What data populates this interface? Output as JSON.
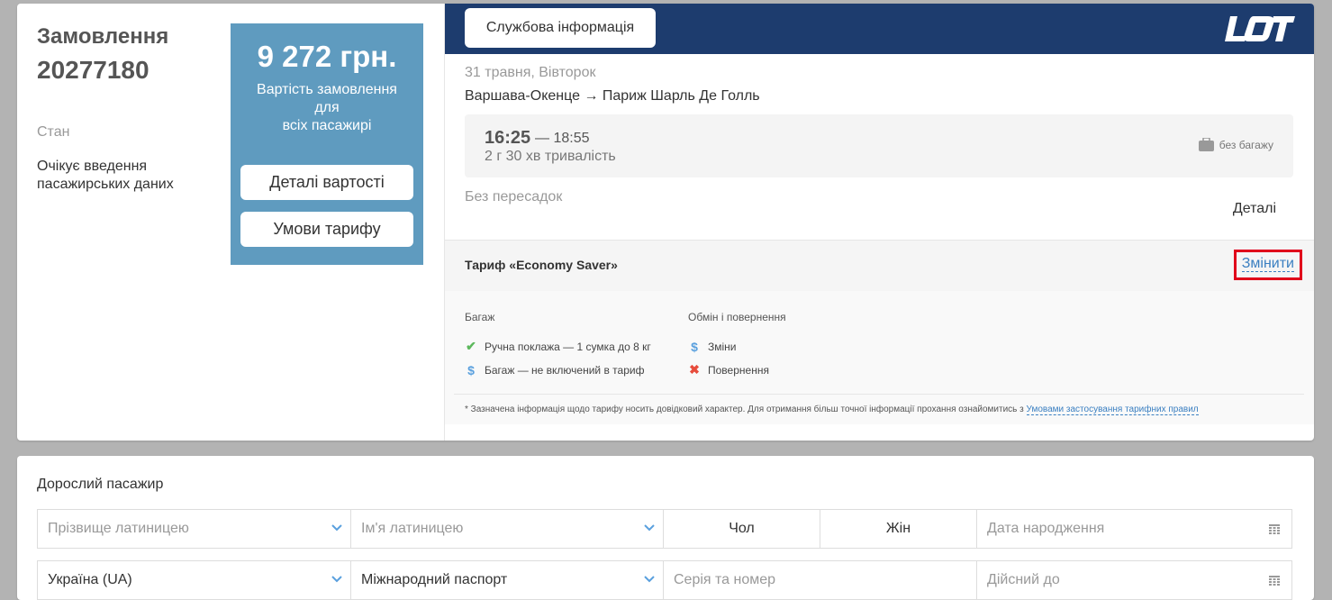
{
  "order": {
    "title": "Замовлення",
    "number": "20277180",
    "status_label": "Стан",
    "status_value": "Очікує введення пасажирських даних"
  },
  "price": {
    "amount": "9 272 грн.",
    "desc_line1": "Вартість замовлення",
    "desc_line2": "для",
    "desc_line3": "всіх пасажирі",
    "details_btn": "Деталі вартості",
    "tariff_btn": "Умови тарифу"
  },
  "header": {
    "service_btn": "Службова інформація",
    "logo_text": "LOT",
    "accent_color": "#1d3c6e"
  },
  "flight": {
    "date": "31 травня, Вівторок",
    "route": "Варшава-Окенце → Париж Шарль Де Голль",
    "dep_time": "16:25",
    "arr_time": "— 18:55",
    "duration": "2 г 30 хв тривалість",
    "baggage": "без багажу",
    "transfers": "Без пересадок",
    "details_link": "Деталі"
  },
  "tariff": {
    "name": "Тариф «Economy Saver»",
    "change_link": "Змінити",
    "baggage_title": "Багаж",
    "baggage_items": [
      {
        "icon": "check-icon",
        "text": "Ручна поклажа — 1 сумка до 8 кг"
      },
      {
        "icon": "dollar-icon",
        "text": "Багаж — не включений в тариф"
      }
    ],
    "exchange_title": "Обмін і повернення",
    "exchange_items": [
      {
        "icon": "dollar-icon",
        "text": "Зміни"
      },
      {
        "icon": "cross-icon",
        "text": "Повернення"
      }
    ],
    "footnote_text": "*  Зазначена інформація щодо тарифу носить довідковий характер. Для отримання більш точної інформації прохання ознайомитись з",
    "footnote_link": "Умовами застосування тарифних правил"
  },
  "passenger": {
    "title": "Дорослий пасажир",
    "surname_placeholder": "Прізвище латиницею",
    "name_placeholder": "Ім'я латиницею",
    "gender_male": "Чол",
    "gender_female": "Жін",
    "birthdate_placeholder": "Дата народження",
    "citizenship": "Україна (UA)",
    "document_type": "Міжнародний паспорт",
    "doc_number_placeholder": "Серія та номер",
    "valid_until_placeholder": "Дійсний до"
  }
}
